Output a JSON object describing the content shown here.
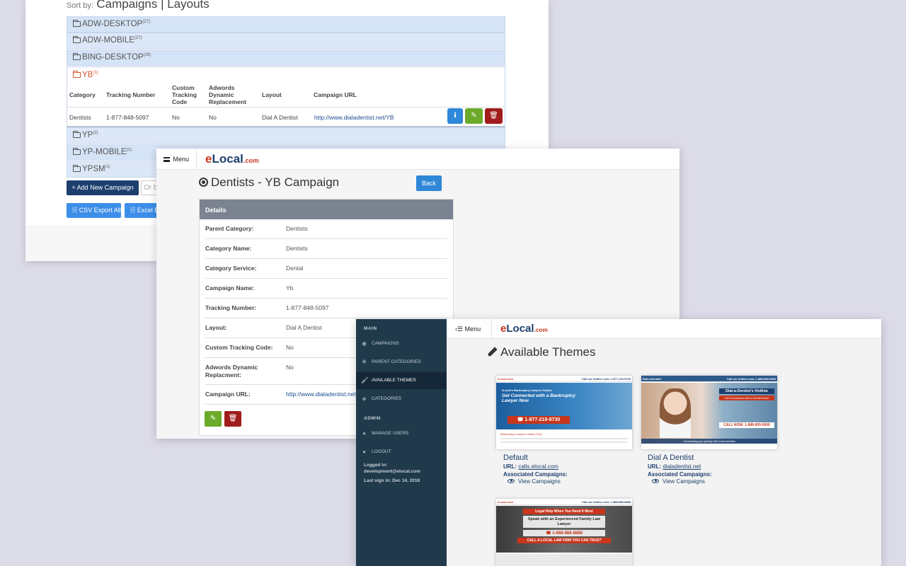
{
  "campaigns_window": {
    "sort_by_label": "Sort by:",
    "sort_by_value": "Campaigns | Layouts",
    "groups_top": [
      {
        "name": "ADW-DESKTOP",
        "count": "(27)"
      },
      {
        "name": "ADW-MOBILE",
        "count": "(27)"
      },
      {
        "name": "BING-DESKTOP",
        "count": "(26)"
      }
    ],
    "open_group": {
      "name": "YB",
      "count": "(1)"
    },
    "table": {
      "headers": [
        "Category",
        "Tracking Number",
        "Custom Tracking Code",
        "Adwords Dynamic Replacement",
        "Layout",
        "Campaign URL"
      ],
      "row": [
        "Dentists",
        "1-877-848-5097",
        "No",
        "No",
        "Dial A Dentist",
        "http://www.dialadentist.net/YB"
      ]
    },
    "groups_bottom": [
      {
        "name": "YP",
        "count": "(2)"
      },
      {
        "name": "YP-MOBILE",
        "count": "(1)"
      },
      {
        "name": "YPSM",
        "count": "(1)"
      }
    ],
    "add_button": "+ Add New Campaign",
    "input_placeholder": "Or b",
    "csv_button": "CSV Export All",
    "excel_button": "Excel Ex"
  },
  "detail_window": {
    "menu_label": "Menu",
    "logo_e": "e",
    "logo_main": "Local",
    "logo_dot": ".com",
    "title": "Dentists - YB Campaign",
    "back_button": "Back",
    "details_heading": "Details",
    "fields": [
      {
        "label": "Parent Category:",
        "value": "Dentists"
      },
      {
        "label": "Category Name:",
        "value": "Dentists"
      },
      {
        "label": "Category Service:",
        "value": "Dental"
      },
      {
        "label": "Campaign Name:",
        "value": "Yb"
      },
      {
        "label": "Tracking Number:",
        "value": "1-877-848-5097"
      },
      {
        "label": "Layout:",
        "value": "Dial A Dentist"
      },
      {
        "label": "Custom Tracking Code:",
        "value": "No"
      },
      {
        "label": "Adwords Dynamic Replacment:",
        "value": "No"
      },
      {
        "label": "Campaign URL:",
        "value": "http://www.dialadentist.net"
      }
    ]
  },
  "themes_window": {
    "sidebar": {
      "main_label": "MAIN",
      "items": [
        "CAMPAIGNS",
        "PARENT CATEGORIES",
        "AVAILABLE THEMES",
        "CATEGORIES"
      ],
      "admin_label": "ADMIN",
      "admin_items": [
        "MANAGE USERS",
        "LOGOUT"
      ],
      "logged_in_label": "Logged in:",
      "logged_in_user": "development@elocal.com",
      "last_sign_in": "Last sign in: Dec 14, 2018"
    },
    "menu_label": "Menu",
    "title": "Available Themes",
    "url_label": "URL:",
    "assoc_label": "Associated Campaigns:",
    "view_label": "View Campaigns",
    "themes": [
      {
        "name": "Default",
        "url": "calls.elocal.com",
        "thumb_top": "Call our hotline now: 1-877-219-9730",
        "thumb_small": "eLocal's Bankruptcy Lawyers Hotline",
        "thumb_headline": "Get Connected with a Bankruptcy Lawyer Now",
        "thumb_phone": "☎ 1-877-219-9730",
        "thumb_faq": "Bankruptcy Lawyers Hotline FAQ"
      },
      {
        "name": "Dial A Dentist",
        "url": "dialadentist.net",
        "thumb_top": "Call our hotline now: 1-888-909-0000",
        "thumb_small": "Dial-a-Dentist's Hotline",
        "thumb_headline": "Get Connected with a Dentist Now!",
        "thumb_phone": "CALL NOW: 1-888-909-0000",
        "thumb_faq": "Connecting you quickly with local dentists"
      },
      {
        "thumb_top": "Call our hotline now: 1-888-888-8888",
        "thumb_small": "Legal Help When You Need It Most",
        "thumb_headline": "Speak with an Experienced Family Law Lawyer",
        "thumb_phone": "☎ 1-888-888-8888",
        "thumb_faq": "CALL A LOCAL LAW FIRM YOU CAN TRUST"
      }
    ]
  }
}
